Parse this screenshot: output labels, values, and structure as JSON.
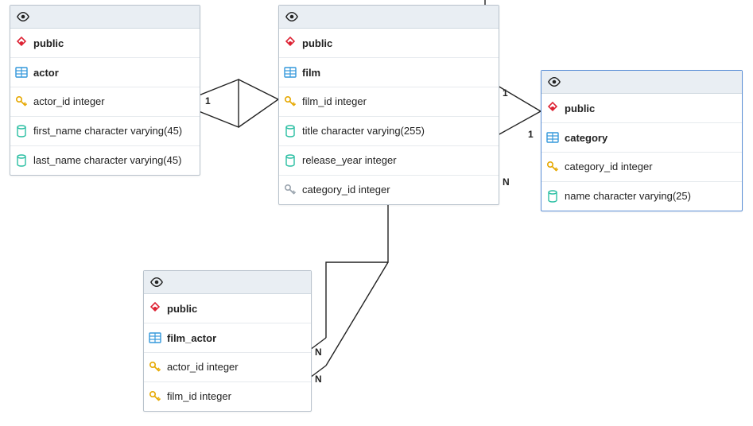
{
  "diagram": {
    "entities": [
      {
        "id": "actor",
        "schema": "public",
        "table": "actor",
        "columns": [
          {
            "name": "actor_id integer",
            "kind": "pk"
          },
          {
            "name": "first_name character varying(45)",
            "kind": "col"
          },
          {
            "name": "last_name character varying(45)",
            "kind": "col"
          }
        ]
      },
      {
        "id": "film",
        "schema": "public",
        "table": "film",
        "columns": [
          {
            "name": "film_id integer",
            "kind": "pk"
          },
          {
            "name": "title character varying(255)",
            "kind": "col"
          },
          {
            "name": "release_year integer",
            "kind": "col"
          },
          {
            "name": "category_id integer",
            "kind": "fk"
          }
        ]
      },
      {
        "id": "category",
        "schema": "public",
        "table": "category",
        "columns": [
          {
            "name": "category_id integer",
            "kind": "pk"
          },
          {
            "name": "name character varying(25)",
            "kind": "col"
          }
        ]
      },
      {
        "id": "film_actor",
        "schema": "public",
        "table": "film_actor",
        "columns": [
          {
            "name": "actor_id integer",
            "kind": "pk"
          },
          {
            "name": "film_id integer",
            "kind": "pk"
          }
        ]
      }
    ],
    "cardinalities": {
      "actor_film_actor_side": "1",
      "film_top_right": "1",
      "film_category_left": "1",
      "film_category_N": "N",
      "film_actor_right_top": "N",
      "film_actor_right_bottom": "N"
    }
  }
}
